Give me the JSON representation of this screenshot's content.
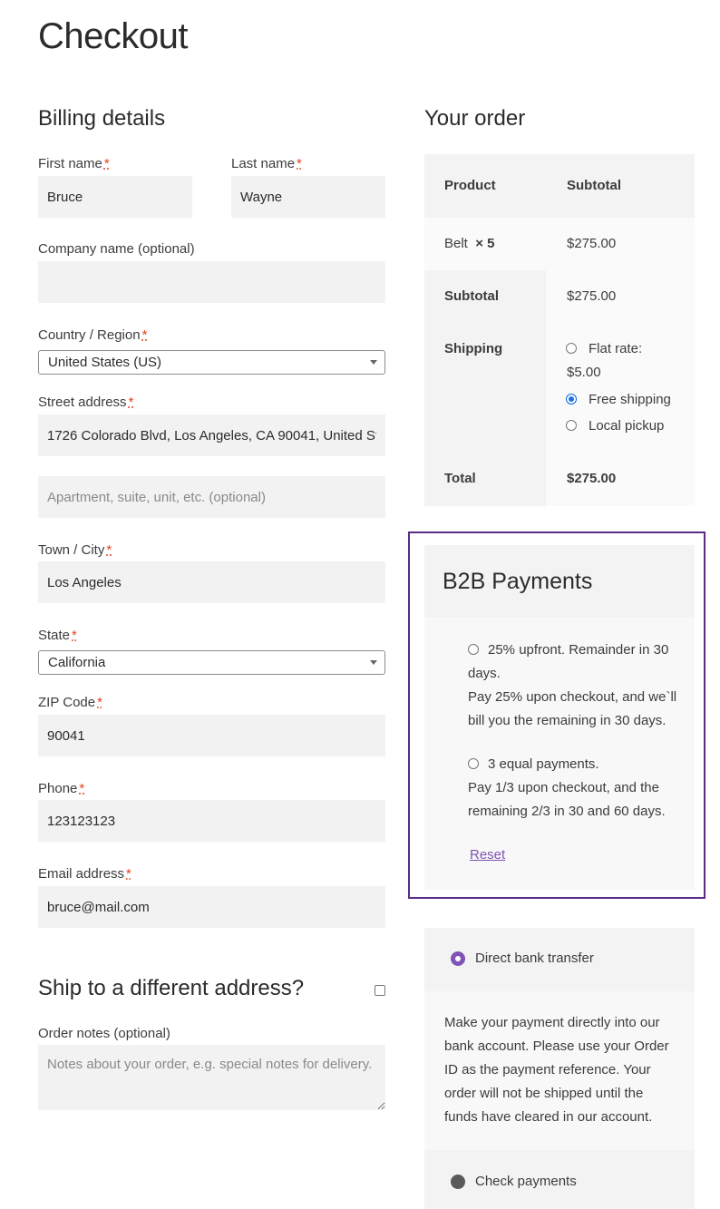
{
  "page": {
    "title": "Checkout"
  },
  "billing": {
    "title": "Billing details",
    "first_name": {
      "label": "First name",
      "value": "Bruce"
    },
    "last_name": {
      "label": "Last name",
      "value": "Wayne"
    },
    "company": {
      "label": "Company name (optional)",
      "value": ""
    },
    "country": {
      "label": "Country / Region",
      "value": "United States (US)"
    },
    "street": {
      "label": "Street address",
      "value": "1726 Colorado Blvd, Los Angeles, CA 90041, United States",
      "placeholder2": "Apartment, suite, unit, etc. (optional)"
    },
    "city": {
      "label": "Town / City",
      "value": "Los Angeles"
    },
    "state": {
      "label": "State",
      "value": "California"
    },
    "zip": {
      "label": "ZIP Code",
      "value": "90041"
    },
    "phone": {
      "label": "Phone",
      "value": "123123123"
    },
    "email": {
      "label": "Email address",
      "value": "bruce@mail.com"
    },
    "required_mark": "*"
  },
  "ship_different": {
    "label": "Ship to a different address?"
  },
  "order_notes": {
    "label": "Order notes (optional)",
    "placeholder": "Notes about your order, e.g. special notes for delivery."
  },
  "order": {
    "title": "Your order",
    "headers": {
      "product": "Product",
      "subtotal": "Subtotal"
    },
    "item": {
      "name": "Belt",
      "qty": "× 5",
      "price": "$275.00"
    },
    "subtotal": {
      "label": "Subtotal",
      "value": "$275.00"
    },
    "shipping": {
      "label": "Shipping",
      "options": [
        {
          "line1": "Flat rate:",
          "line2": "$5.00",
          "checked": false
        },
        {
          "line1": "Free shipping",
          "checked": true
        },
        {
          "line1": "Local pickup",
          "checked": false
        }
      ]
    },
    "total": {
      "label": "Total",
      "value": "$275.00"
    }
  },
  "b2b": {
    "title": "B2B Payments",
    "options": [
      {
        "title_line1": "25% upfront. Remainder in 30",
        "title_line2": "days.",
        "desc_line1": "Pay 25% upon checkout, and we`ll",
        "desc_line2": "bill you the remaining in 30 days."
      },
      {
        "title_line1": "3 equal payments.",
        "desc_line1": "Pay 1/3 upon checkout, and the",
        "desc_line2": "remaining 2/3 in 30 and 60 days."
      }
    ],
    "reset_label": "Reset"
  },
  "payment_methods": {
    "bank": {
      "label": "Direct bank transfer",
      "desc": [
        "Make your payment directly into our",
        "bank account. Please use your Order",
        "ID as the payment reference. Your",
        "order will not be shipped until the",
        "funds have cleared in our account."
      ]
    },
    "check": {
      "label": "Check payments"
    }
  },
  "colors": {
    "accent": "#7f54b3",
    "b2b_border": "#5b2a86",
    "required": "#e2401c"
  }
}
